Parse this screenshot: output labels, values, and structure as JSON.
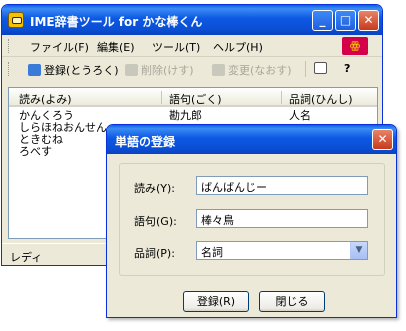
{
  "main_window": {
    "title": "IME辞書ツール for かな棒くん",
    "caption_buttons": {
      "minimize": "_",
      "maximize": "□",
      "close": "✕"
    },
    "menu": [
      "ファイル(F)",
      "編集(E)",
      "ツール(T)",
      "ヘルプ(H)"
    ],
    "toolbar": {
      "register": "登録(とうろく)",
      "delete": "削除(けす)",
      "modify": "変更(なおす)",
      "help": "?"
    },
    "columns": [
      "読み(よみ)",
      "語句(ごく)",
      "品詞(ひんし)"
    ],
    "rows": [
      {
        "reading": "かんくろう",
        "word": "勘九郎",
        "pos": "人名"
      },
      {
        "reading": "しらほねおんせん",
        "word": "",
        "pos": ""
      },
      {
        "reading": "ときむね",
        "word": "",
        "pos": ""
      },
      {
        "reading": "ろべす",
        "word": "",
        "pos": ""
      }
    ],
    "status": "レディ"
  },
  "dialog": {
    "title": "単語の登録",
    "close": "✕",
    "reading_label": "読み(Y):",
    "reading_value": "ばんばんじー",
    "word_label": "語句(G):",
    "word_value": "棒々鳥",
    "pos_label": "品詞(P):",
    "pos_value": "名詞",
    "register_button": "登録(R)",
    "close_button": "閉じる"
  },
  "colors": {
    "titlebar": "#0a4fd4",
    "window_face": "#ece9d8",
    "close_button": "#c8391b",
    "input_border": "#7f9db9"
  }
}
